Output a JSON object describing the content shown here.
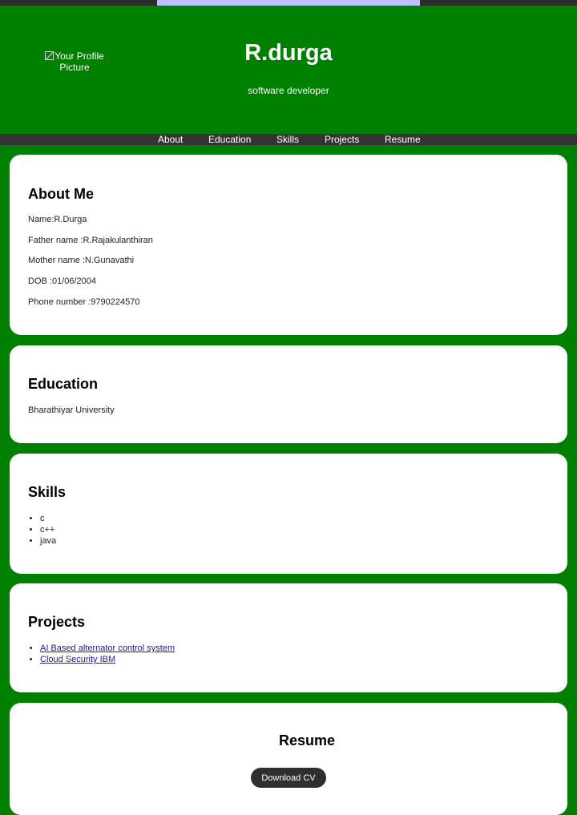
{
  "header": {
    "profile_picture_alt": "Your Profile Picture",
    "name": "R.durga",
    "role": "software developer",
    "progress_fraction": 0.455
  },
  "nav": {
    "items": [
      {
        "label": "About"
      },
      {
        "label": "Education"
      },
      {
        "label": "Skills"
      },
      {
        "label": "Projects"
      },
      {
        "label": "Resume"
      }
    ]
  },
  "about": {
    "title": "About Me",
    "lines": [
      "Name:R.Durga",
      "Father name :R.Rajakulanthiran",
      "Mother name :N.Gunavathi",
      "DOB :01/06/2004",
      "Phone number :9790224570"
    ]
  },
  "education": {
    "title": "Education",
    "lines": [
      "Bharathiyar University"
    ]
  },
  "skills": {
    "title": "Skills",
    "items": [
      "c",
      "c++",
      "java"
    ]
  },
  "projects": {
    "title": "Projects",
    "items": [
      "AI Based alternator control system",
      "Cloud Security IBM"
    ]
  },
  "resume": {
    "title": "Resume",
    "button_label": "Download CV"
  },
  "colors": {
    "page_background": "#008000",
    "nav_background": "#333333",
    "card_background": "#ffffff",
    "button_background": "#2f2f2f",
    "progress_bar": "#b9c4ff",
    "link": "#1a1aa6"
  }
}
